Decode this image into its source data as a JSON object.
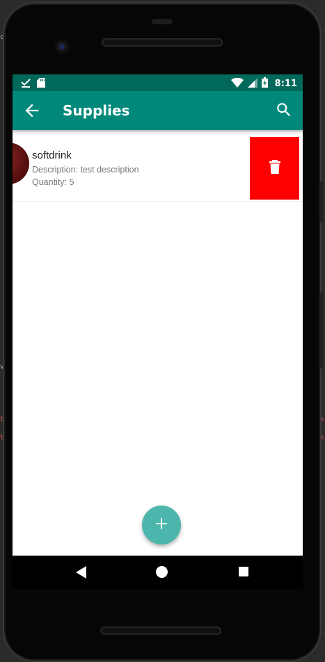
{
  "status_bar": {
    "time": "8:11",
    "left_icons": [
      "download-done-icon",
      "sd-card-icon"
    ],
    "right_icons": [
      "wifi-icon",
      "cell-signal-icon",
      "battery-charging-icon"
    ]
  },
  "toolbar": {
    "title": "Supplies",
    "back_icon": "arrow-back-icon",
    "search_icon": "search-icon",
    "background": "#00897b"
  },
  "supplies": [
    {
      "name": "softdrink",
      "description": "Description: test description",
      "quantity": "Quantity: 5",
      "delete_icon": "trash-icon",
      "delete_color": "#ff0000"
    }
  ],
  "fab": {
    "icon": "plus-icon",
    "color": "#4db6ac"
  },
  "nav_bar": {
    "icons": [
      "back-triangle-icon",
      "home-circle-icon",
      "recents-square-icon"
    ]
  },
  "ide_edge": {
    "left_fragments": [
      "c",
      "v",
      "t",
      "t"
    ],
    "right_fragments": [
      "m",
      "m"
    ]
  }
}
